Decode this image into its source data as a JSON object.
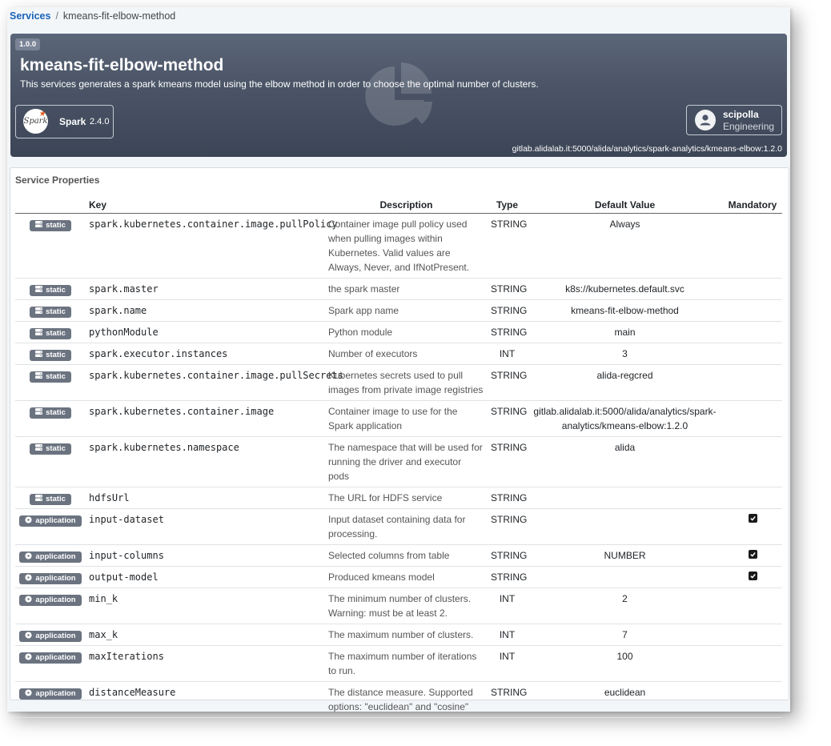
{
  "breadcrumb": {
    "root": "Services",
    "separator": "/",
    "current": "kmeans-fit-elbow-method"
  },
  "service": {
    "version": "1.0.0",
    "title": "kmeans-fit-elbow-method",
    "description": "This services generates a spark kmeans model using the elbow method in order to choose the optimal number of clusters.",
    "framework": {
      "logo_text": "Spark",
      "name": "Spark",
      "version": "2.4.0"
    },
    "owner": {
      "name": "scipolla",
      "team": "Engineering"
    },
    "image": "gitlab.alidalab.it:5000/alida/analytics/spark-analytics/kmeans-elbow:1.2.0"
  },
  "properties": {
    "title": "Service Properties",
    "columns": [
      "Key",
      "Description",
      "Type",
      "Default Value",
      "Mandatory"
    ],
    "rows": [
      {
        "badge": "static",
        "key": "spark.kubernetes.container.image.pullPolicy",
        "description": "Container image pull policy used when pulling images within Kubernetes. Valid values are Always, Never, and IfNotPresent.",
        "type": "STRING",
        "default": "Always",
        "mandatory": false
      },
      {
        "badge": "static",
        "key": "spark.master",
        "description": "the spark master",
        "type": "STRING",
        "default": "k8s://kubernetes.default.svc",
        "mandatory": false
      },
      {
        "badge": "static",
        "key": "spark.name",
        "description": "Spark app name",
        "type": "STRING",
        "default": "kmeans-fit-elbow-method",
        "mandatory": false
      },
      {
        "badge": "static",
        "key": "pythonModule",
        "description": "Python module",
        "type": "STRING",
        "default": "main",
        "mandatory": false
      },
      {
        "badge": "static",
        "key": "spark.executor.instances",
        "description": "Number of executors",
        "type": "INT",
        "default": "3",
        "mandatory": false
      },
      {
        "badge": "static",
        "key": "spark.kubernetes.container.image.pullSecrets",
        "description": "Kubernetes secrets used to pull images from private image registries",
        "type": "STRING",
        "default": "alida-regcred",
        "mandatory": false
      },
      {
        "badge": "static",
        "key": "spark.kubernetes.container.image",
        "description": "Container image to use for the Spark application",
        "type": "STRING",
        "default": "gitlab.alidalab.it:5000/alida/analytics/spark-analytics/kmeans-elbow:1.2.0",
        "mandatory": false
      },
      {
        "badge": "static",
        "key": "spark.kubernetes.namespace",
        "description": "The namespace that will be used for running the driver and executor pods",
        "type": "STRING",
        "default": "alida",
        "mandatory": false
      },
      {
        "badge": "static",
        "key": "hdfsUrl",
        "description": "The URL for HDFS service",
        "type": "STRING",
        "default": "",
        "mandatory": false
      },
      {
        "badge": "application",
        "key": "input-dataset",
        "description": "Input dataset containing data for processing.",
        "type": "STRING",
        "default": "",
        "mandatory": true
      },
      {
        "badge": "application",
        "key": "input-columns",
        "description": "Selected columns from table",
        "type": "STRING",
        "default": "NUMBER",
        "mandatory": true
      },
      {
        "badge": "application",
        "key": "output-model",
        "description": "Produced kmeans model",
        "type": "STRING",
        "default": "",
        "mandatory": true
      },
      {
        "badge": "application",
        "key": "min_k",
        "description": "The minimum number of clusters. Warning: must be at least 2.",
        "type": "INT",
        "default": "2",
        "mandatory": false
      },
      {
        "badge": "application",
        "key": "max_k",
        "description": "The maximum number of clusters.",
        "type": "INT",
        "default": "7",
        "mandatory": false
      },
      {
        "badge": "application",
        "key": "maxIterations",
        "description": "The maximum number of iterations to run.",
        "type": "INT",
        "default": "100",
        "mandatory": false
      },
      {
        "badge": "application",
        "key": "distanceMeasure",
        "description": "The distance measure. Supported options: \"euclidean\" and \"cosine\"",
        "type": "STRING",
        "default": "euclidean",
        "mandatory": false
      }
    ]
  }
}
